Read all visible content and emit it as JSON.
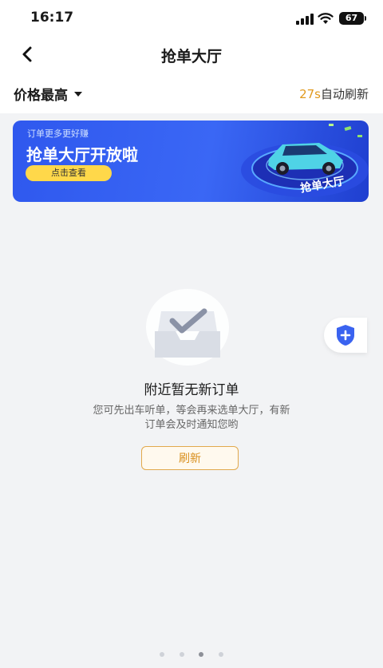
{
  "status_bar": {
    "time": "16:17",
    "battery": "67"
  },
  "nav": {
    "title": "抢单大厅"
  },
  "filter": {
    "sort_label": "价格最高",
    "countdown": "27s",
    "countdown_suffix": "自动刷新"
  },
  "banner": {
    "subtitle": "订单更多更好赚",
    "title": "抢单大厅开放啦",
    "button": "点击查看",
    "art_label": "抢单大厅"
  },
  "empty": {
    "title": "附近暂无新订单",
    "description_line1": "您可先出车听单，等会再来选单大厅，有新",
    "description_line2": "订单会及时通知您哟",
    "refresh_button": "刷新"
  },
  "pager": {
    "count": 4,
    "active_index": 2
  }
}
